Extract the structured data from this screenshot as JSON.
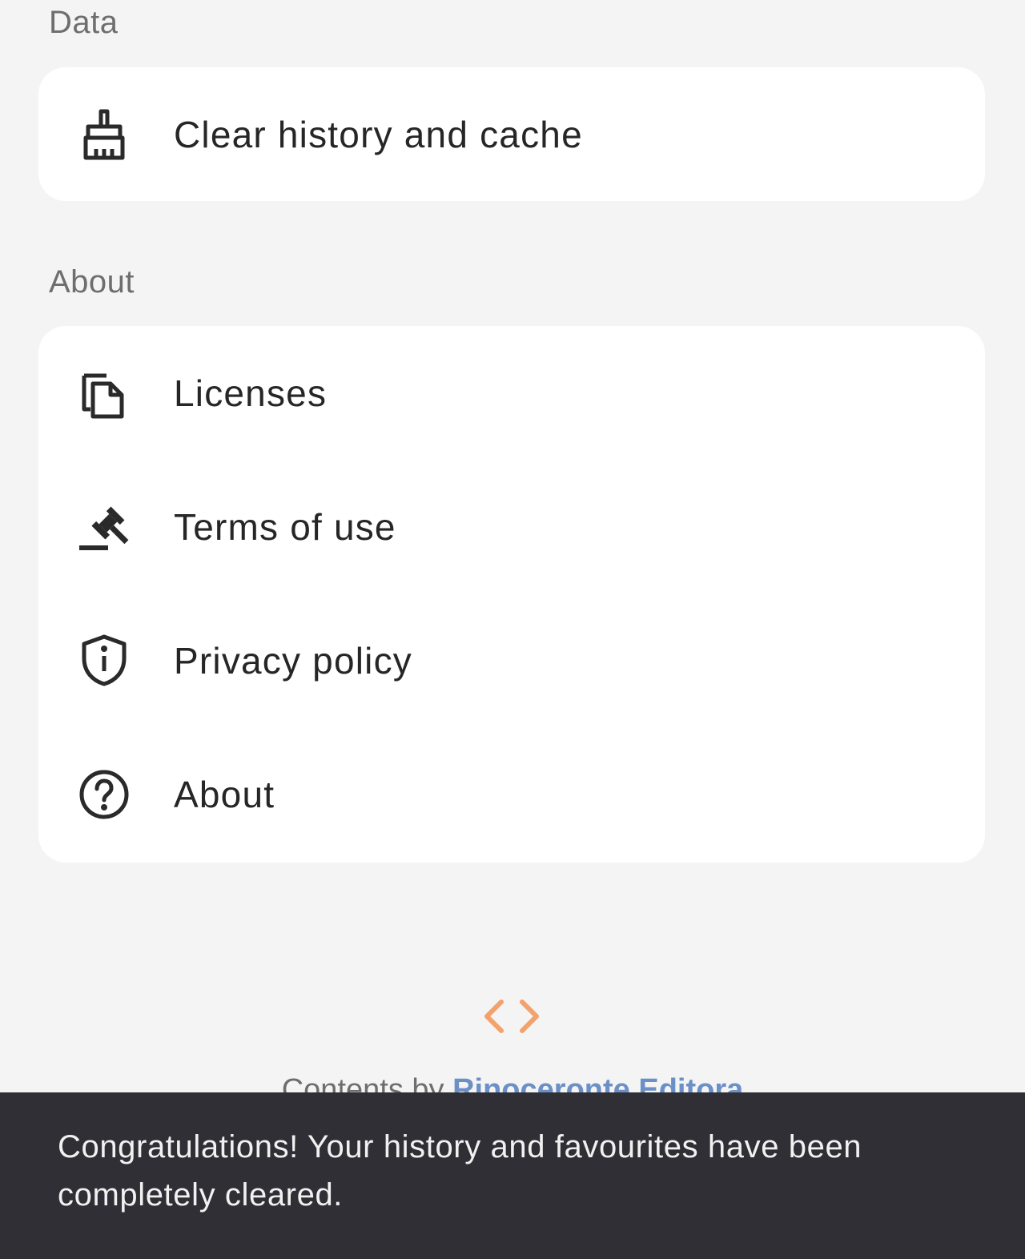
{
  "sections": {
    "data": {
      "title": "Data",
      "items": [
        {
          "label": "Clear history and cache",
          "icon": "broom-icon"
        }
      ]
    },
    "about": {
      "title": "About",
      "items": [
        {
          "label": "Licenses",
          "icon": "copy-document-icon"
        },
        {
          "label": "Terms of use",
          "icon": "gavel-icon"
        },
        {
          "label": "Privacy policy",
          "icon": "shield-info-icon"
        },
        {
          "label": "About",
          "icon": "help-circle-icon"
        }
      ]
    }
  },
  "footer": {
    "icon": "code-icon",
    "credit_prefix": "Contents by",
    "credit_link": "Rinoceronte Editora",
    "accent_color": "#f4a26b",
    "link_color": "#6b8fc7"
  },
  "snackbar": {
    "message": "Congratulations! Your history and favourites have been completely cleared."
  }
}
